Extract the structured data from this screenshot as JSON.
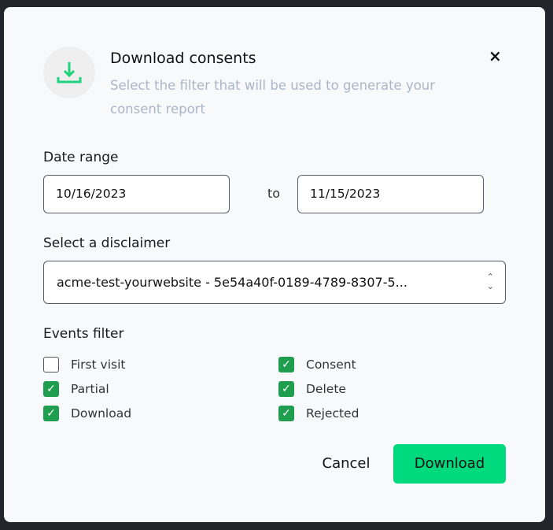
{
  "header": {
    "title": "Download consents",
    "subtitle": "Select the filter that will be used to generate your consent report",
    "icon": "download-icon",
    "close_icon": "×"
  },
  "date_range": {
    "label": "Date range",
    "from": "10/16/2023",
    "separator": "to",
    "to": "11/15/2023"
  },
  "disclaimer": {
    "label": "Select a disclaimer",
    "value": "acme-test-yourwebsite - 5e54a40f-0189-4789-8307-5..."
  },
  "events": {
    "label": "Events filter",
    "items": [
      {
        "label": "First visit",
        "checked": false
      },
      {
        "label": "Partial",
        "checked": true
      },
      {
        "label": "Download",
        "checked": true
      },
      {
        "label": "Consent",
        "checked": true
      },
      {
        "label": "Delete",
        "checked": true
      },
      {
        "label": "Rejected",
        "checked": true
      }
    ]
  },
  "actions": {
    "cancel": "Cancel",
    "download": "Download"
  },
  "colors": {
    "accent": "#00d97e",
    "checkbox": "#1e9e4e",
    "overlay": "#23252c"
  }
}
